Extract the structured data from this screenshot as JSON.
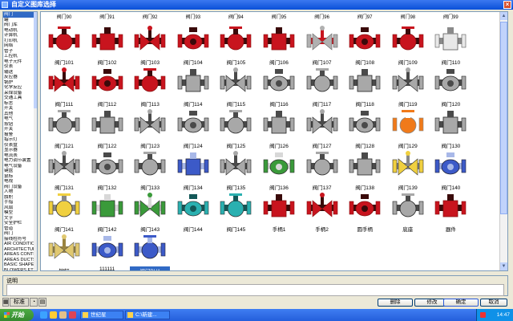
{
  "window": {
    "title": "自定义图库选择"
  },
  "categories": [
    "阀门",
    "罐",
    "阀门库",
    "电动机",
    "计算机",
    "打印机",
    "网络",
    "管子",
    "工控机",
    "电子元件",
    "仪表",
    "输送",
    "反应器",
    "锅炉",
    "化学反应",
    "采煤设备",
    "交通工具",
    "标志",
    "开关",
    "其他",
    "电气",
    "按钮",
    "开关",
    "报警",
    "指示灯",
    "仪表盘",
    "显示器",
    "电流表",
    "电力调节装置",
    "电气设备",
    "键盘",
    "鼠标",
    "电视",
    "阀门设备",
    "人物",
    "旗帜",
    "手指",
    "风扇",
    "模型",
    "文字",
    "安全护栏",
    "管道",
    "阀门",
    "接线柱符号",
    "AIR CONDITION",
    "ARCHITECTURAL",
    "AREAS CONTRO",
    "AREAS DUCTS",
    "BASIC SHAPES",
    "BLOWERS ETC",
    "BUILDINGS",
    "CHEMICAL",
    "COMPUTER HARD",
    "CONTAINERS",
    "CONTROLLERS",
    "CONVEYORS, BE",
    "CONVEYORS, SD",
    "DUCTS",
    "ELECTRICAL"
  ],
  "top_partial_labels": [
    "阀门90",
    "阀门91",
    "阀门92",
    "阀门93",
    "阀门94",
    "阀门95",
    "阀门96",
    "阀门97",
    "阀门98",
    "阀门99"
  ],
  "gallery": [
    {
      "label": "阀门101",
      "icon": "red-gate-valve-icon"
    },
    {
      "label": "阀门102",
      "icon": "red-flanged-valve-icon"
    },
    {
      "label": "阀门103",
      "icon": "red-ball-valve-icon"
    },
    {
      "label": "阀门104",
      "icon": "red-valve-icon"
    },
    {
      "label": "阀门105",
      "icon": "red-sphere-valve-icon"
    },
    {
      "label": "阀门106",
      "icon": "red-globe-valve-icon"
    },
    {
      "label": "阀门107",
      "icon": "grey-red-valve-icon"
    },
    {
      "label": "阀门108",
      "icon": "red-double-flange-valve-icon"
    },
    {
      "label": "阀门109",
      "icon": "red-round-valve-icon"
    },
    {
      "label": "阀门110",
      "icon": "white-flange-valve-icon"
    },
    {
      "label": "阀门111",
      "icon": "red-gate-valve-icon"
    },
    {
      "label": "阀门112",
      "icon": "red-square-valve-icon"
    },
    {
      "label": "阀门113",
      "icon": "red-cross-valve-icon"
    },
    {
      "label": "阀门114",
      "icon": "grey-actuator-valve-icon"
    },
    {
      "label": "阀门115",
      "icon": "grey-motor-valve-icon"
    },
    {
      "label": "阀门116",
      "icon": "grey-needle-valve-icon"
    },
    {
      "label": "阀门117",
      "icon": "grey-butterfly-valve-icon"
    },
    {
      "label": "阀门118",
      "icon": "grey-diaphragm-valve-icon"
    },
    {
      "label": "阀门119",
      "icon": "grey-angle-valve-icon"
    },
    {
      "label": "阀门120",
      "icon": "grey-flanged-valve-icon"
    },
    {
      "label": "阀门121",
      "icon": "grey-check-valve-icon"
    },
    {
      "label": "阀门122",
      "icon": "grey-block-valve-icon"
    },
    {
      "label": "阀门123",
      "icon": "grey-lever-valve-icon"
    },
    {
      "label": "阀门124",
      "icon": "grey-pressure-valve-icon"
    },
    {
      "label": "阀门125",
      "icon": "grey-disc-valve-icon"
    },
    {
      "label": "阀门126",
      "icon": "grey-stem-valve-icon"
    },
    {
      "label": "阀门127",
      "icon": "grey-wheel-valve-icon"
    },
    {
      "label": "阀门128",
      "icon": "grey-handle-valve-icon"
    },
    {
      "label": "阀门129",
      "icon": "orange-grip-valve-icon"
    },
    {
      "label": "阀门130",
      "icon": "grey-tee-valve-icon"
    },
    {
      "label": "阀门131",
      "icon": "grey-clamp-valve-icon"
    },
    {
      "label": "阀门132",
      "icon": "grey-column-valve-icon"
    },
    {
      "label": "阀门133",
      "icon": "grey-y-valve-icon"
    },
    {
      "label": "阀门134",
      "icon": "blue-motor-valve-icon"
    },
    {
      "label": "阀门135",
      "icon": "grey-sphere-valve-icon"
    },
    {
      "label": "阀门136",
      "icon": "green-arrow-valve-icon"
    },
    {
      "label": "阀门137",
      "icon": "grey-four-way-valve-icon"
    },
    {
      "label": "阀门138",
      "icon": "grey-round-valve-icon"
    },
    {
      "label": "阀门139",
      "icon": "yellow-actuator-valve-icon"
    },
    {
      "label": "阀门140",
      "icon": "blue-frame-valve-icon"
    },
    {
      "label": "阀门141",
      "icon": "yellow-indicator-valve-icon"
    },
    {
      "label": "阀门142",
      "icon": "green-grey-valve-icon"
    },
    {
      "label": "阀门143",
      "icon": "green-display-valve-icon"
    },
    {
      "label": "阀门144",
      "icon": "teal-motor-valve-icon"
    },
    {
      "label": "阀门145",
      "icon": "teal-valve-icon"
    },
    {
      "label": "手柄1",
      "icon": "red-handle-icon"
    },
    {
      "label": "手柄2",
      "icon": "red-u-handle-icon"
    },
    {
      "label": "圆手柄",
      "icon": "red-round-handle-icon"
    },
    {
      "label": "底座",
      "icon": "grey-base-icon"
    },
    {
      "label": "器件",
      "icon": "red-device-icon"
    },
    {
      "label": "铆钉",
      "icon": "tan-rivet-icon"
    },
    {
      "label": "111111",
      "icon": "blue-pipe-icon"
    },
    {
      "label": "阀门BH1",
      "icon": "blue-valve-icon",
      "selected": true
    }
  ],
  "description": {
    "label": "说明",
    "text": ""
  },
  "toolbar": {
    "std_label": "标准",
    "b1": "◔",
    "b2": "▤"
  },
  "buttons": {
    "delete": "删除",
    "modify": "修改",
    "ok": "确定",
    "cancel": "取消"
  },
  "taskbar": {
    "start_label": "开始",
    "task1": "世纪星",
    "task2": "C:\\新建...",
    "clock": "14:47"
  },
  "colors": {
    "title_bar": "#0a50d8",
    "selection": "#316ac5",
    "valve_red": "#c8141e",
    "valve_dark": "#3a0a0a"
  }
}
